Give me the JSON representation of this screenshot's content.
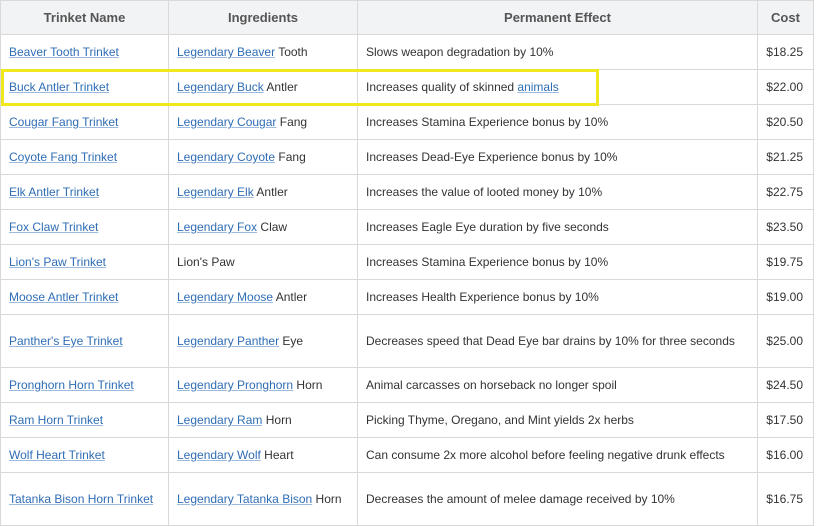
{
  "headers": [
    "Trinket Name",
    "Ingredients",
    "Permanent Effect",
    "Cost"
  ],
  "rows": [
    {
      "name": "Beaver Tooth Trinket",
      "ing_link": "Legendary Beaver",
      "ing_rest": " Tooth",
      "effect_text": "Slows weapon degradation by 10%",
      "effect_link": "",
      "cost": "$18.25"
    },
    {
      "name": "Buck Antler Trinket",
      "ing_link": "Legendary Buck",
      "ing_rest": " Antler",
      "effect_text": "Increases quality of skinned ",
      "effect_link": "animals",
      "cost": "$22.00"
    },
    {
      "name": "Cougar Fang Trinket",
      "ing_link": "Legendary Cougar",
      "ing_rest": " Fang",
      "effect_text": "Increases Stamina Experience bonus by 10%",
      "effect_link": "",
      "cost": "$20.50"
    },
    {
      "name": "Coyote Fang Trinket",
      "ing_link": "Legendary Coyote",
      "ing_rest": " Fang",
      "effect_text": "Increases Dead-Eye Experience bonus by 10%",
      "effect_link": "",
      "cost": "$21.25"
    },
    {
      "name": "Elk Antler Trinket",
      "ing_link": "Legendary Elk",
      "ing_rest": " Antler",
      "effect_text": "Increases the value of looted money by 10%",
      "effect_link": "",
      "cost": "$22.75"
    },
    {
      "name": "Fox Claw Trinket",
      "ing_link": "Legendary Fox",
      "ing_rest": " Claw",
      "effect_text": "Increases Eagle Eye duration by five seconds",
      "effect_link": "",
      "cost": "$23.50"
    },
    {
      "name": "Lion's Paw Trinket",
      "ing_link": "",
      "ing_rest": "Lion's Paw",
      "effect_text": "Increases Stamina Experience bonus by 10%",
      "effect_link": "",
      "cost": "$19.75"
    },
    {
      "name": "Moose Antler Trinket",
      "ing_link": "Legendary Moose",
      "ing_rest": " Antler",
      "effect_text": "Increases Health Experience bonus by 10%",
      "effect_link": "",
      "cost": "$19.00"
    },
    {
      "name": "Panther's Eye Trinket",
      "ing_link": "Legendary Panther",
      "ing_rest": " Eye",
      "effect_text": "Decreases speed that Dead Eye bar drains by 10% for three seconds",
      "effect_link": "",
      "cost": "$25.00"
    },
    {
      "name": "Pronghorn Horn Trinket",
      "ing_link": "Legendary Pronghorn",
      "ing_rest": " Horn",
      "effect_text": "Animal carcasses on horseback no longer spoil",
      "effect_link": "",
      "cost": "$24.50"
    },
    {
      "name": "Ram Horn Trinket",
      "ing_link": "Legendary Ram",
      "ing_rest": " Horn",
      "effect_text": "Picking Thyme, Oregano, and Mint yields 2x herbs",
      "effect_link": "",
      "cost": "$17.50"
    },
    {
      "name": "Wolf Heart Trinket",
      "ing_link": "Legendary Wolf",
      "ing_rest": " Heart",
      "effect_text": "Can consume 2x more alcohol before feeling negative drunk effects",
      "effect_link": "",
      "cost": "$16.00"
    },
    {
      "name": "Tatanka Bison Horn Trinket",
      "ing_link": "Legendary Tatanka Bison",
      "ing_rest": " Horn",
      "effect_text": "Decreases the amount of melee damage received by 10%",
      "effect_link": "",
      "cost": "$16.75"
    }
  ],
  "highlight": {
    "row": "Buck Antler Trinket",
    "color": "#f0e81c"
  },
  "colors": {
    "link": "#2f6db5",
    "header_bg": "#f2f3f5",
    "border": "#d9d9d9"
  }
}
